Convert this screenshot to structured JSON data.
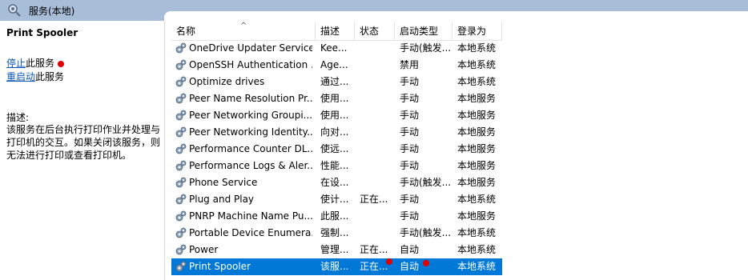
{
  "window": {
    "title": "服务(本地)"
  },
  "left_pane": {
    "service_name": "Print Spooler",
    "stop_link": "停止",
    "stop_suffix": "此服务",
    "restart_link": "重启动",
    "restart_suffix": "此服务",
    "description_label": "描述:",
    "description_text": "该服务在后台执行打印作业并处理与打印机的交互。如果关闭该服务，则无法进行打印或查看打印机。"
  },
  "columns": {
    "name": "名称",
    "desc": "描述",
    "status": "状态",
    "start": "启动类型",
    "login": "登录为"
  },
  "rows": [
    {
      "name": "OneDrive Updater Service",
      "desc": "Kee...",
      "status": "",
      "start": "手动(触发...",
      "login": "本地系统"
    },
    {
      "name": "OpenSSH Authentication ...",
      "desc": "Age...",
      "status": "",
      "start": "禁用",
      "login": "本地系统"
    },
    {
      "name": "Optimize drives",
      "desc": "通过...",
      "status": "",
      "start": "手动",
      "login": "本地系统"
    },
    {
      "name": "Peer Name Resolution Pr...",
      "desc": "使用...",
      "status": "",
      "start": "手动",
      "login": "本地服务"
    },
    {
      "name": "Peer Networking Groupi...",
      "desc": "使用...",
      "status": "",
      "start": "手动",
      "login": "本地服务"
    },
    {
      "name": "Peer Networking Identity...",
      "desc": "向对...",
      "status": "",
      "start": "手动",
      "login": "本地服务"
    },
    {
      "name": "Performance Counter DL...",
      "desc": "使远...",
      "status": "",
      "start": "手动",
      "login": "本地服务"
    },
    {
      "name": "Performance Logs & Aler...",
      "desc": "性能...",
      "status": "",
      "start": "手动",
      "login": "本地服务"
    },
    {
      "name": "Phone Service",
      "desc": "在设...",
      "status": "",
      "start": "手动(触发...",
      "login": "本地服务"
    },
    {
      "name": "Plug and Play",
      "desc": "使计...",
      "status": "正在...",
      "start": "手动",
      "login": "本地系统"
    },
    {
      "name": "PNRP Machine Name Pu...",
      "desc": "此服...",
      "status": "",
      "start": "手动",
      "login": "本地服务"
    },
    {
      "name": "Portable Device Enumera...",
      "desc": "强制...",
      "status": "",
      "start": "手动(触发...",
      "login": "本地系统"
    },
    {
      "name": "Power",
      "desc": "管理...",
      "status": "正在...",
      "start": "自动",
      "login": "本地系统"
    },
    {
      "name": "Print Spooler",
      "desc": "该服...",
      "status": "正在...",
      "start": "自动",
      "login": "本地系统"
    }
  ],
  "selected_row_index": 13,
  "colors": {
    "selection": "#0078d7",
    "titlebar": "#a7bdd8",
    "link": "#0b57b8",
    "marker": "#e00000"
  }
}
